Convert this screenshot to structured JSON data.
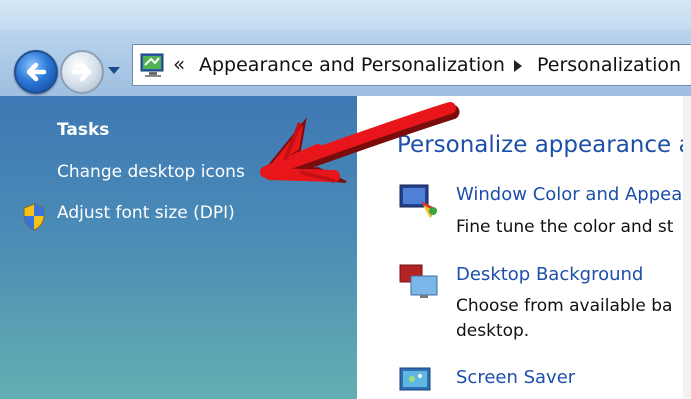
{
  "address_bar": {
    "chevron": "«",
    "crumbs": [
      "Appearance and Personalization",
      "Personalization"
    ]
  },
  "left_pane": {
    "heading": "Tasks",
    "tasks": [
      "Change desktop icons",
      "Adjust font size (DPI)"
    ]
  },
  "main": {
    "heading": "Personalize appearance a",
    "items": [
      {
        "title": "Window Color and Appea",
        "desc_lines": [
          "Fine tune the color and st"
        ]
      },
      {
        "title": "Desktop Background",
        "desc_lines": [
          "Choose from available ba",
          "desktop."
        ]
      },
      {
        "title": "Screen Saver",
        "desc_lines": []
      }
    ]
  },
  "annotation": {
    "type": "red-arrow",
    "color": "#e8161b",
    "points_to": "Change desktop icons"
  },
  "colors": {
    "link": "#1c4faa",
    "left_pane": "#4a8bb6",
    "heading": "#1d4fa8"
  }
}
